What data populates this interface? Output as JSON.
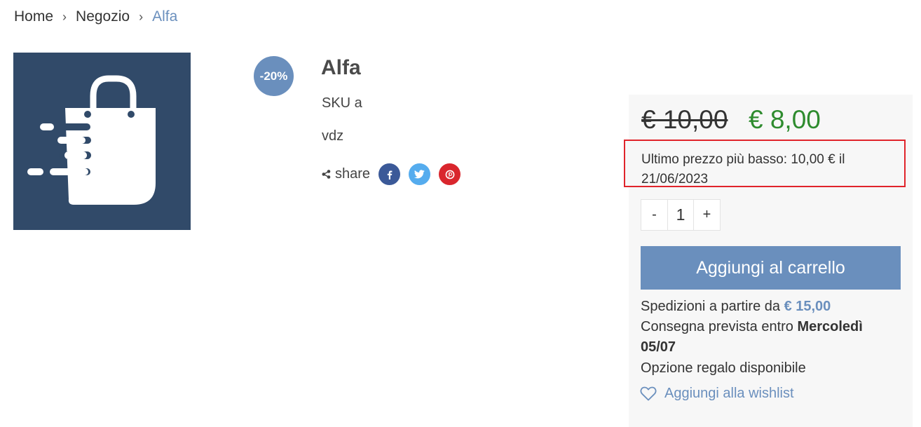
{
  "breadcrumb": {
    "home": "Home",
    "shop": "Negozio",
    "current": "Alfa",
    "separator": "›"
  },
  "product": {
    "title": "Alfa",
    "sku": "SKU a",
    "description": "vdz",
    "discount_badge": "-20%",
    "image_icon": "shopping-bag-icon",
    "image_bg_color": "#314a69"
  },
  "share": {
    "label": "share",
    "icons": [
      "share-icon",
      "facebook-icon",
      "twitter-icon",
      "pinterest-icon"
    ]
  },
  "pricing": {
    "old_price": "€ 10,00",
    "new_price": "€ 8,00",
    "lowest_price_text": "Ultimo prezzo più basso: 10,00 € il 21/06/2023",
    "new_price_color": "#2e8b2e"
  },
  "quantity": {
    "minus": "-",
    "value": "1",
    "plus": "+"
  },
  "cart": {
    "button_label": "Aggiungi al carrello",
    "accent_color": "#6a8fbd"
  },
  "shipping": {
    "label": "Spedizioni a partire da ",
    "price": "€ 15,00",
    "delivery_label": "Consegna prevista entro ",
    "delivery_date": "Mercoledì 05/07",
    "gift": "Opzione regalo disponibile"
  },
  "wishlist": {
    "label": "Aggiungi alla wishlist",
    "icon": "heart-icon"
  }
}
